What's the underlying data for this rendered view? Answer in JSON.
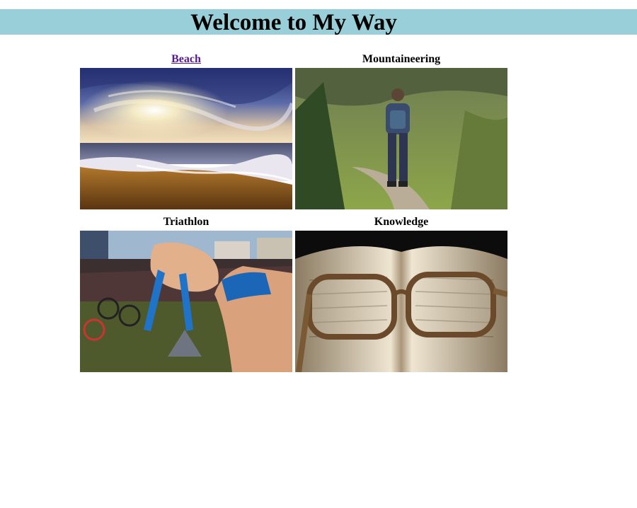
{
  "header": {
    "title": "Welcome to My Way"
  },
  "gallery": [
    {
      "caption": "Beach",
      "is_link": true,
      "image": "sunset-beach-photo"
    },
    {
      "caption": "Mountaineering",
      "is_link": false,
      "image": "hiker-on-trail-photo"
    },
    {
      "caption": "Triathlon",
      "is_link": false,
      "image": "hand-holding-medal-photo"
    },
    {
      "caption": "Knowledge",
      "is_link": false,
      "image": "glasses-on-book-photo"
    }
  ],
  "colors": {
    "banner": "#98cfd9",
    "link_visited": "#551a8b"
  }
}
